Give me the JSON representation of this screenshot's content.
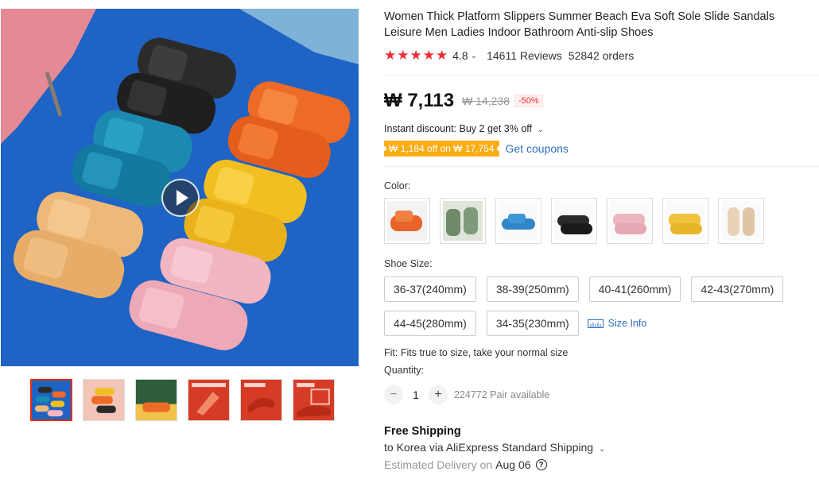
{
  "product": {
    "title": "Women Thick Platform Slippers Summer Beach Eva Soft Sole Slide Sandals Leisure Men Ladies Indoor Bathroom Anti-slip Shoes",
    "rating": "4.8",
    "reviews": "14611 Reviews",
    "orders": "52842 orders"
  },
  "price": {
    "current": "₩ 7,113",
    "original": "₩ 14,238",
    "discount": "-50%"
  },
  "promo": {
    "instant_discount": "Instant discount: Buy 2 get 3% off",
    "coupon_badge": "₩ 1,184 off on ₩ 17,754",
    "get_coupons": "Get coupons"
  },
  "color_section": {
    "label": "Color:",
    "swatches": [
      {
        "name": "orange",
        "color": "#e8642a"
      },
      {
        "name": "green",
        "color": "#7f9a78"
      },
      {
        "name": "blue",
        "color": "#2f86c9"
      },
      {
        "name": "black",
        "color": "#2a2a2a"
      },
      {
        "name": "pink",
        "color": "#ecb6c0"
      },
      {
        "name": "yellow",
        "color": "#efc23c"
      },
      {
        "name": "beige",
        "color": "#e9d3b8"
      }
    ]
  },
  "size_section": {
    "label": "Shoe Size:",
    "sizes": [
      "36-37(240mm)",
      "38-39(250mm)",
      "40-41(260mm)",
      "42-43(270mm)",
      "44-45(280mm)",
      "34-35(230mm)"
    ],
    "size_info": "Size Info"
  },
  "fit_text": "Fit: Fits true to size, take your normal size",
  "quantity": {
    "label": "Quantity:",
    "value": "1",
    "minus": "−",
    "plus": "+",
    "available": "224772 Pair available"
  },
  "shipping": {
    "title": "Free Shipping",
    "line": "to Korea via AliExpress Standard Shipping",
    "estimated_label": "Estimated Delivery on",
    "estimated_date": "Aug 06",
    "help": "?"
  },
  "icons": {
    "star": "star-icon",
    "chevron": "chevron-down-icon",
    "play": "play-icon",
    "ruler": "ruler-icon",
    "help": "question-circle-icon"
  },
  "colors": {
    "accent_red": "#f02d34",
    "coupon_orange": "#fbad14",
    "link_blue": "#2d6ebf"
  }
}
